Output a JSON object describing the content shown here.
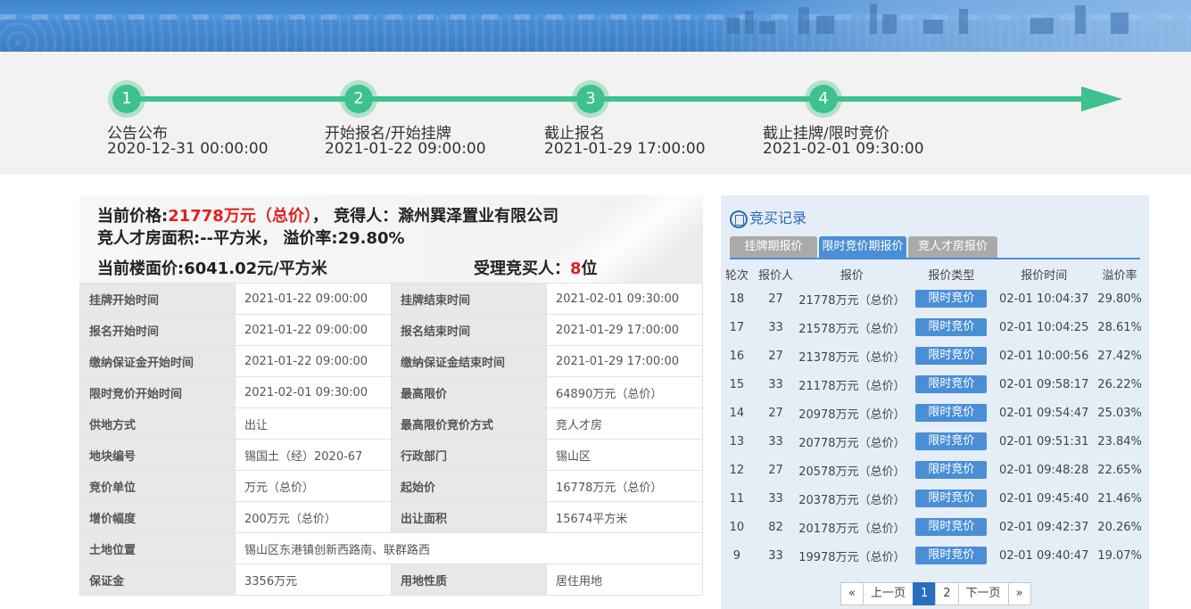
{
  "timeline": {
    "steps": [
      {
        "num": "1",
        "label": "公告公布",
        "time": "2020-12-31 00:00:00"
      },
      {
        "num": "2",
        "label": "开始报名/开始挂牌",
        "time": "2021-01-22 09:00:00"
      },
      {
        "num": "3",
        "label": "截止报名",
        "time": "2021-01-29 17:00:00"
      },
      {
        "num": "4",
        "label": "截止挂牌/限时竞价",
        "time": "2021-02-01 09:30:00"
      }
    ]
  },
  "summary": {
    "price_label": "当前价格:",
    "price_value": "21778万元（总价）",
    "winner_label": "，  竞得人：",
    "winner_value": "滁州巽泽置业有限公司",
    "area_line": "竞人才房面积:--平方米，  溢价率:29.80%",
    "floor_price_line": "当前楼面价:6041.02元/平方米",
    "bidders_label": "受理竞买人：",
    "bidders_value": "8",
    "bidders_unit": "位"
  },
  "info": [
    [
      "挂牌开始时间",
      "2021-01-22 09:00:00",
      "挂牌结束时间",
      "2021-02-01 09:30:00"
    ],
    [
      "报名开始时间",
      "2021-01-22 09:00:00",
      "报名结束时间",
      "2021-01-29 17:00:00"
    ],
    [
      "缴纳保证金开始时间",
      "2021-01-22 09:00:00",
      "缴纳保证金结束时间",
      "2021-01-29 17:00:00"
    ],
    [
      "限时竞价开始时间",
      "2021-02-01 09:30:00",
      "最高限价",
      "64890万元（总价）"
    ],
    [
      "供地方式",
      "出让",
      "最高限价竞价方式",
      "竞人才房"
    ],
    [
      "地块编号",
      "锡国土（经）2020-67",
      "行政部门",
      "锡山区"
    ],
    [
      "竞价单位",
      "万元（总价）",
      "起始价",
      "16778万元（总价）"
    ],
    [
      "增价幅度",
      "200万元（总价）",
      "出让面积",
      "15674平方米"
    ],
    [
      "土地位置",
      "锡山区东港镇创新西路南、联群路西"
    ],
    [
      "保证金",
      "3356万元",
      "用地性质",
      "居住用地"
    ]
  ],
  "records": {
    "title": "竞买记录",
    "tabs": [
      "挂牌期报价",
      "限时竞价期报价",
      "竞人才房报价"
    ],
    "active_tab": 1,
    "headers": [
      "轮次",
      "报价人",
      "报价",
      "报价类型",
      "报价时间",
      "溢价率"
    ],
    "rows": [
      [
        "18",
        "27",
        "21778万元（总价）",
        "限时竞价",
        "02-01 10:04:37",
        "29.80%"
      ],
      [
        "17",
        "33",
        "21578万元（总价）",
        "限时竞价",
        "02-01 10:04:25",
        "28.61%"
      ],
      [
        "16",
        "27",
        "21378万元（总价）",
        "限时竞价",
        "02-01 10:00:56",
        "27.42%"
      ],
      [
        "15",
        "33",
        "21178万元（总价）",
        "限时竞价",
        "02-01 09:58:17",
        "26.22%"
      ],
      [
        "14",
        "27",
        "20978万元（总价）",
        "限时竞价",
        "02-01 09:54:47",
        "25.03%"
      ],
      [
        "13",
        "33",
        "20778万元（总价）",
        "限时竞价",
        "02-01 09:51:31",
        "23.84%"
      ],
      [
        "12",
        "27",
        "20578万元（总价）",
        "限时竞价",
        "02-01 09:48:28",
        "22.65%"
      ],
      [
        "11",
        "33",
        "20378万元（总价）",
        "限时竞价",
        "02-01 09:45:40",
        "21.46%"
      ],
      [
        "10",
        "82",
        "20178万元（总价）",
        "限时竞价",
        "02-01 09:42:37",
        "20.26%"
      ],
      [
        "9",
        "33",
        "19978万元（总价）",
        "限时竞价",
        "02-01 09:40:47",
        "19.07%"
      ]
    ],
    "pager": [
      "«",
      "上一页",
      "1",
      "2",
      "下一页",
      "»"
    ],
    "current_page": "1"
  },
  "colors": {
    "accent_green": "#3ec18c",
    "accent_blue": "#4a8fd6",
    "price_red": "#e02020"
  }
}
